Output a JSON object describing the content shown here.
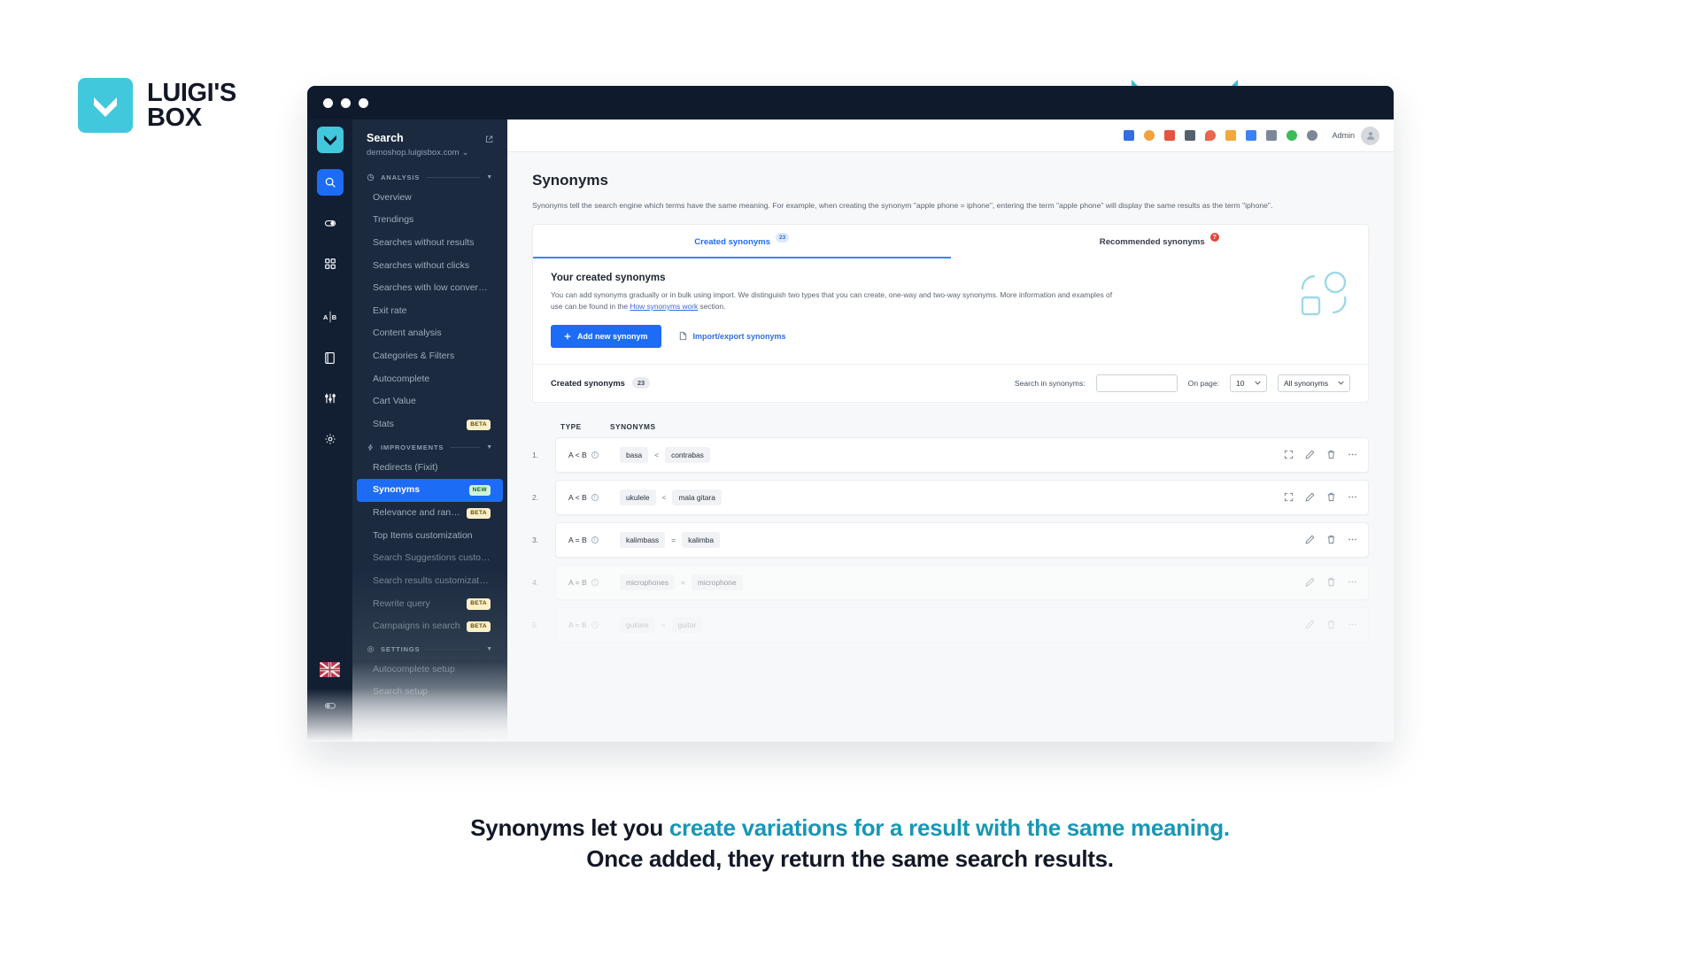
{
  "brand": {
    "name_line1": "LUIGI'S",
    "name_line2": "BOX",
    "logo_icon": "chevron-down-icon",
    "accent_color": "#41c8dd"
  },
  "caption": {
    "line1_plain": "Synonyms let you ",
    "line1_accent": "create variations for a result with the same meaning.",
    "line2": "Once added, they return the same search results.",
    "accent_color": "#1897b5"
  },
  "window": {
    "traffic_lights": [
      "close",
      "minimize",
      "maximize"
    ]
  },
  "rail": {
    "logo_icon": "luigis-box-chevron-icon",
    "items": [
      {
        "icon": "search-icon",
        "name": "rail-search",
        "active": true
      },
      {
        "icon": "toggle-icon",
        "name": "rail-toggle",
        "active": false
      },
      {
        "icon": "grid-icon",
        "name": "rail-grid",
        "active": false
      },
      {
        "icon": "ab-test-icon",
        "name": "rail-ab-test",
        "active": false
      },
      {
        "icon": "book-icon",
        "name": "rail-book",
        "active": false
      },
      {
        "icon": "sliders-icon",
        "name": "rail-sliders",
        "active": false
      },
      {
        "icon": "gear-icon",
        "name": "rail-settings",
        "active": false
      }
    ],
    "bottom": [
      {
        "icon": "flag-icon",
        "name": "rail-language-flag",
        "label": "EN"
      },
      {
        "icon": "toggle-icon",
        "name": "rail-bottom-toggle",
        "label": ""
      }
    ]
  },
  "nav": {
    "title": "Search",
    "subtitle": "demoshop.luigisbox.com",
    "subtitle_caret": "⌄",
    "external_icon": "external-link-icon",
    "groups": [
      {
        "label": "ANALYSIS",
        "icon": "chart-pie-icon",
        "items": [
          {
            "label": "Overview",
            "badge": "",
            "active": false
          },
          {
            "label": "Trendings",
            "badge": "",
            "active": false
          },
          {
            "label": "Searches without results",
            "badge": "",
            "active": false
          },
          {
            "label": "Searches without clicks",
            "badge": "",
            "active": false
          },
          {
            "label": "Searches with low conversions",
            "badge": "",
            "active": false
          },
          {
            "label": "Exit rate",
            "badge": "",
            "active": false
          },
          {
            "label": "Content analysis",
            "badge": "",
            "active": false
          },
          {
            "label": "Categories & Filters",
            "badge": "",
            "active": false
          },
          {
            "label": "Autocomplete",
            "badge": "",
            "active": false
          },
          {
            "label": "Cart Value",
            "badge": "",
            "active": false
          },
          {
            "label": "Stats",
            "badge": "BETA",
            "badge_kind": "beta",
            "active": false
          }
        ]
      },
      {
        "label": "IMPROVEMENTS",
        "icon": "spark-icon",
        "items": [
          {
            "label": "Redirects (Fixit)",
            "badge": "",
            "active": false
          },
          {
            "label": "Synonyms",
            "badge": "NEW",
            "badge_kind": "new",
            "active": true
          },
          {
            "label": "Relevance and ranking",
            "badge": "BETA",
            "badge_kind": "beta",
            "active": false
          },
          {
            "label": "Top Items customization",
            "badge": "",
            "active": false
          },
          {
            "label": "Search Suggestions customiza...",
            "badge": "",
            "active": false
          },
          {
            "label": "Search results customization",
            "badge": "",
            "active": false
          },
          {
            "label": "Rewrite query",
            "badge": "BETA",
            "badge_kind": "beta",
            "active": false
          },
          {
            "label": "Campaigns in search",
            "badge": "BETA",
            "badge_kind": "beta",
            "active": false
          }
        ]
      },
      {
        "label": "SETTINGS",
        "icon": "gear-icon",
        "items": [
          {
            "label": "Autocomplete setup",
            "badge": "",
            "active": false
          },
          {
            "label": "Search setup",
            "badge": "",
            "active": false
          }
        ]
      }
    ]
  },
  "topbar": {
    "icons": [
      "briefcase-icon",
      "user-icon",
      "chart-icon",
      "search-icon",
      "flame-icon",
      "list-icon",
      "window-icon",
      "mobile-icon",
      "circle-icon",
      "gear-icon"
    ],
    "user_label": "Admin",
    "avatar_icon": "avatar-icon"
  },
  "page": {
    "title": "Synonyms",
    "description": "Synonyms tell the search engine which terms have the same meaning. For example, when creating the synonym \"apple phone = iphone\", entering the term \"apple phone\" will display the same results as the term \"iphone\"."
  },
  "tabs": [
    {
      "label": "Created synonyms",
      "count": "23",
      "active": true
    },
    {
      "label": "Recommended synonyms",
      "alert": "?",
      "active": false
    }
  ],
  "panel": {
    "heading": "Your created synonyms",
    "text_before_link": "You can add synonyms gradually or in bulk using import. We distinguish two types that you can create, one-way and two-way synonyms. More information and examples of use can be found in the ",
    "link_text": "How synonyms work",
    "text_after_link": " section.",
    "add_button": "Add new synonym",
    "add_button_icon": "plus-icon",
    "import_button": "Import/export synonyms",
    "import_button_icon": "file-icon"
  },
  "filterbar": {
    "title": "Created synonyms",
    "count": "23",
    "search_label": "Search in synonyms:",
    "search_value": "",
    "search_placeholder": "",
    "onpage_label": "On page:",
    "onpage_value": "10",
    "filter_value": "All synonyms",
    "chevron_icon": "chevron-down-icon"
  },
  "table": {
    "columns": [
      "TYPE",
      "SYNONYMS"
    ],
    "rows": [
      {
        "index": "1.",
        "type": "A < B",
        "left": "basa",
        "op": "<",
        "right": "contrabas",
        "actions": [
          "expand-icon",
          "edit-icon",
          "trash-icon",
          "more-icon"
        ],
        "opacity": "full"
      },
      {
        "index": "2.",
        "type": "A < B",
        "left": "ukulele",
        "op": "<",
        "right": "mala gitara",
        "actions": [
          "expand-icon",
          "edit-icon",
          "trash-icon",
          "more-icon"
        ],
        "opacity": "full"
      },
      {
        "index": "3.",
        "type": "A = B",
        "left": "kalimbass",
        "op": "=",
        "right": "kalimba",
        "actions": [
          "edit-icon",
          "trash-icon",
          "more-icon"
        ],
        "opacity": "full"
      },
      {
        "index": "4.",
        "type": "A = B",
        "left": "microphones",
        "op": "=",
        "right": "microphone",
        "actions": [
          "edit-icon",
          "trash-icon",
          "more-icon"
        ],
        "opacity": "faded"
      },
      {
        "index": "5.",
        "type": "A = B",
        "left": "guitare",
        "op": "=",
        "right": "guitar",
        "actions": [
          "edit-icon",
          "trash-icon",
          "more-icon"
        ],
        "opacity": "faded2"
      }
    ]
  }
}
